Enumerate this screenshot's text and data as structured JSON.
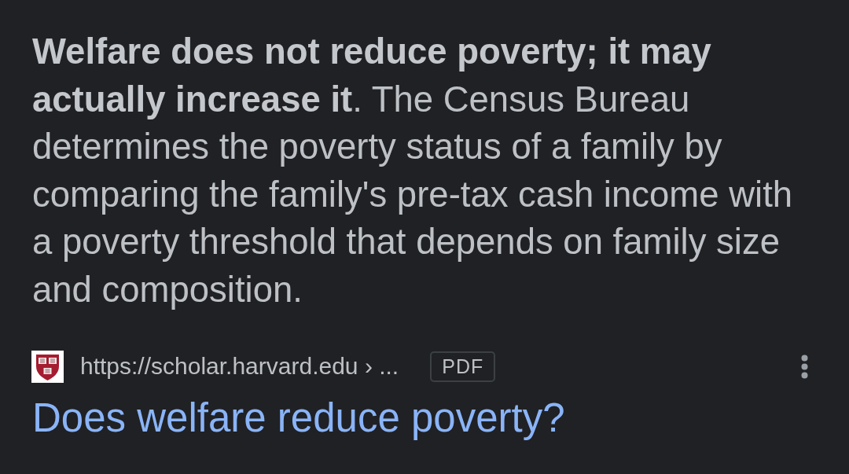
{
  "snippet": {
    "text": "**Welfare does not reduce poverty; it may actually increase it**. The Census Bureau determines the poverty status of a family by comparing the family's pre-tax cash income with a poverty threshold that depends on family size and composition."
  },
  "result": {
    "url": "https://scholar.harvard.edu › ...",
    "badge": "PDF",
    "title": "Does welfare reduce poverty?"
  }
}
